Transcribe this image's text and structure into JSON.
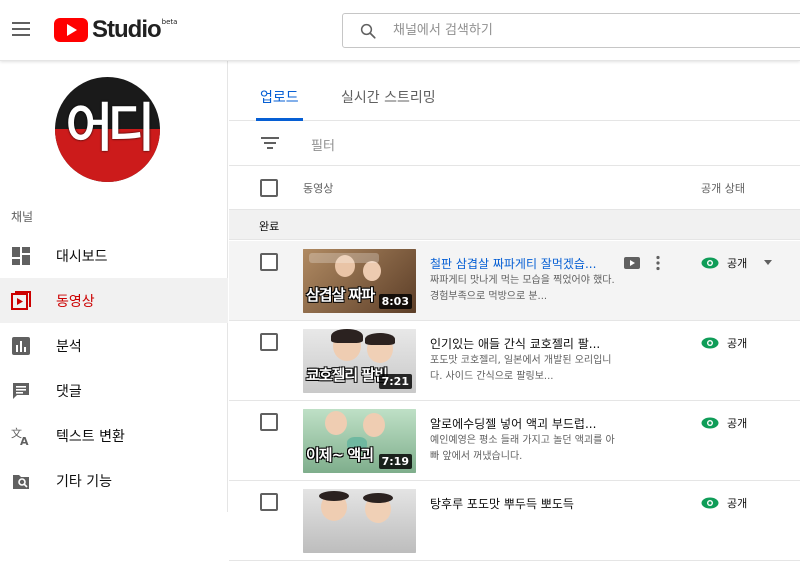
{
  "header": {
    "logo_text": "Studio",
    "logo_beta": "beta",
    "search_placeholder": "채널에서 검색하기"
  },
  "sidebar": {
    "avatar_text": "어디",
    "channel_label": "채널",
    "items": [
      {
        "label": "대시보드",
        "icon": "dashboard-icon",
        "active": false
      },
      {
        "label": "동영상",
        "icon": "video-icon",
        "active": true
      },
      {
        "label": "분석",
        "icon": "analytics-icon",
        "active": false
      },
      {
        "label": "댓글",
        "icon": "comments-icon",
        "active": false
      },
      {
        "label": "텍스트 변환",
        "icon": "translate-icon",
        "active": false
      },
      {
        "label": "기타 기능",
        "icon": "other-features-icon",
        "active": false
      }
    ]
  },
  "tabs": [
    {
      "label": "업로드",
      "active": true
    },
    {
      "label": "실시간 스트리밍",
      "active": false
    }
  ],
  "filter": {
    "label": "필터"
  },
  "columns": {
    "video": "동영상",
    "status": "공개 상태"
  },
  "section": {
    "label": "완료"
  },
  "videos": [
    {
      "title": "철판 삼겹살 짜파게티 잘먹겠습...",
      "description": "짜파게티 맛나게 먹는 모습을 찍었어야 했다. 경험부족으로 먹방으로 분...",
      "duration": "8:03",
      "thumb_text": "삼겹살 짜파",
      "status": "공개",
      "colors": {
        "bg": "#8a6a4a",
        "accent": "#c98d5b"
      }
    },
    {
      "title": "인기있는 애들 간식 쿄호젤리 팔...",
      "description": "포도맛 코호젤리, 일본에서 개발된 오리입니다. 사이드 간식으로 팔링보...",
      "duration": "7:21",
      "thumb_text": "쿄호젤리 팔빈",
      "status": "공개",
      "colors": {
        "bg": "#dadada",
        "accent": "#8b5a3c"
      }
    },
    {
      "title": "알로에수딩젤 넣어 액괴 부드럽...",
      "description": "예인예영은 평소 들래 가지고 놀던 액괴를 아빠 앞에서 꺼냈습니다.",
      "duration": "7:19",
      "thumb_text": "이제~ 액괴",
      "status": "공개",
      "colors": {
        "bg": "#a8d1b4",
        "accent": "#5b8f6c"
      }
    },
    {
      "title": "탕후루 포도맛 뿌두득 뽀도득",
      "description": "",
      "duration": "",
      "thumb_text": "",
      "status": "공개",
      "colors": {
        "bg": "#d0d0d0",
        "accent": "#9a6a52"
      }
    }
  ],
  "colors": {
    "accent_red": "#cc0000",
    "link_blue": "#065fd4",
    "public_green": "#0f9d58"
  }
}
